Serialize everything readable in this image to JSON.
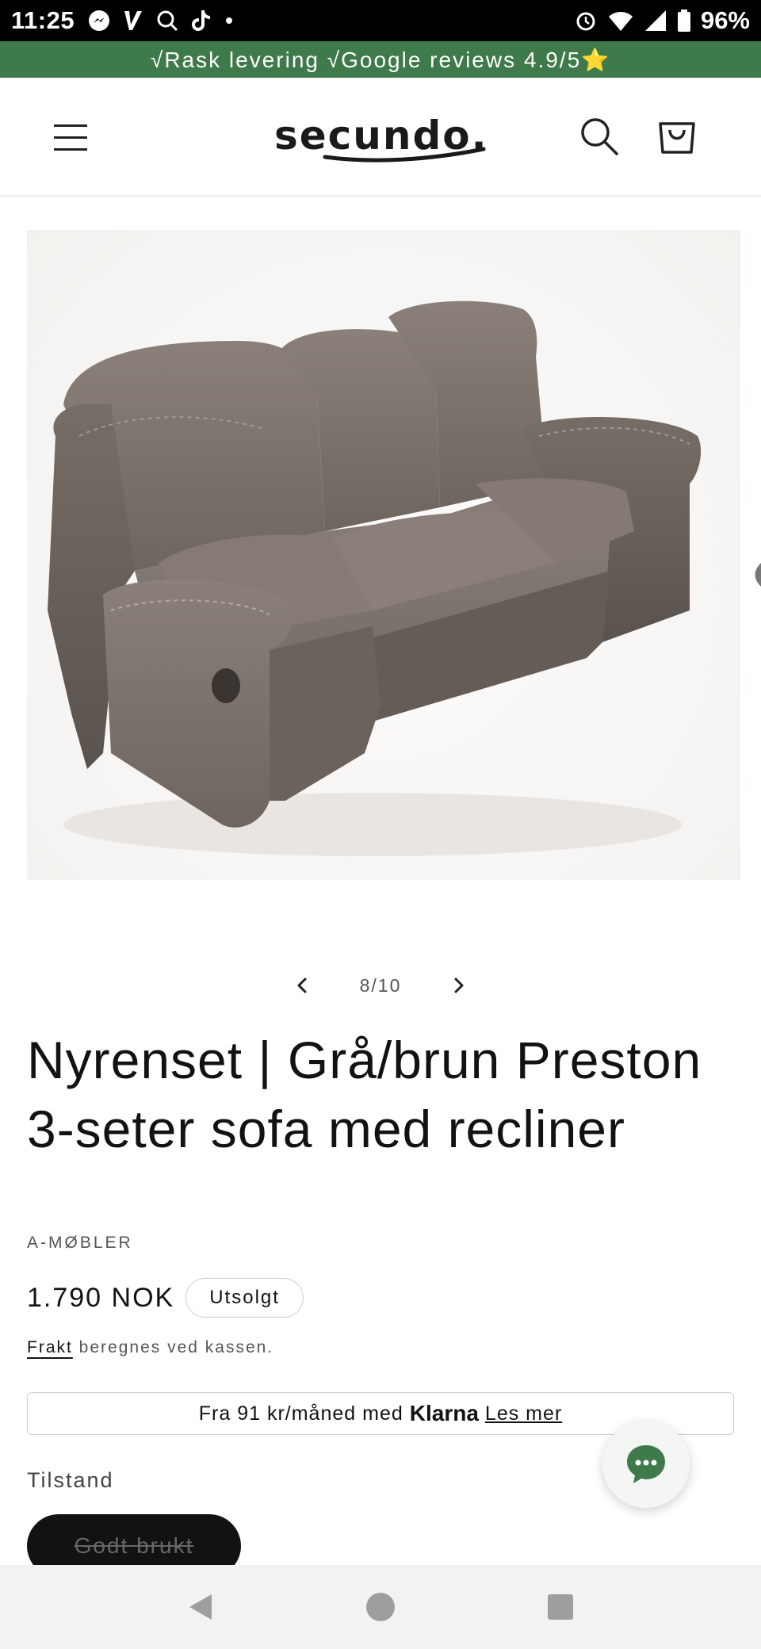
{
  "status_bar": {
    "time": "11:25",
    "battery": "96%",
    "icons": [
      "messenger-icon",
      "v-app-icon",
      "search-icon",
      "tiktok-icon",
      "dot-icon",
      "alarm-icon",
      "wifi-icon",
      "signal-icon",
      "battery-icon"
    ]
  },
  "announcement": {
    "text": "√Rask levering √Google reviews 4.9/5⭐"
  },
  "header": {
    "logo_text": "secundo.",
    "icons": [
      "menu-icon",
      "search-icon",
      "cart-icon"
    ]
  },
  "gallery": {
    "counter": "8/10",
    "prev_icon": "chevron-left-icon",
    "next_icon": "chevron-right-icon"
  },
  "product": {
    "title": "Nyrenset | Grå/brun Preston 3-seter sofa med recliner",
    "vendor": "A-MØBLER",
    "price": "1.790 NOK",
    "badge": "Utsolgt",
    "shipping_link": "Frakt",
    "shipping_text": " beregnes ved kassen."
  },
  "klarna": {
    "prefix": "Fra 91 kr/måned med",
    "logo": "Klarna",
    "link": "Les mer"
  },
  "condition": {
    "label": "Tilstand",
    "option": "Godt brukt"
  },
  "chat": {
    "icon": "chat-bubble-icon",
    "color": "#3e7a4a"
  },
  "colors": {
    "announcement_bg": "#3e7a4a",
    "text": "#121212"
  },
  "nav_bar": {
    "icons": [
      "back-icon",
      "home-icon",
      "recents-icon"
    ]
  }
}
